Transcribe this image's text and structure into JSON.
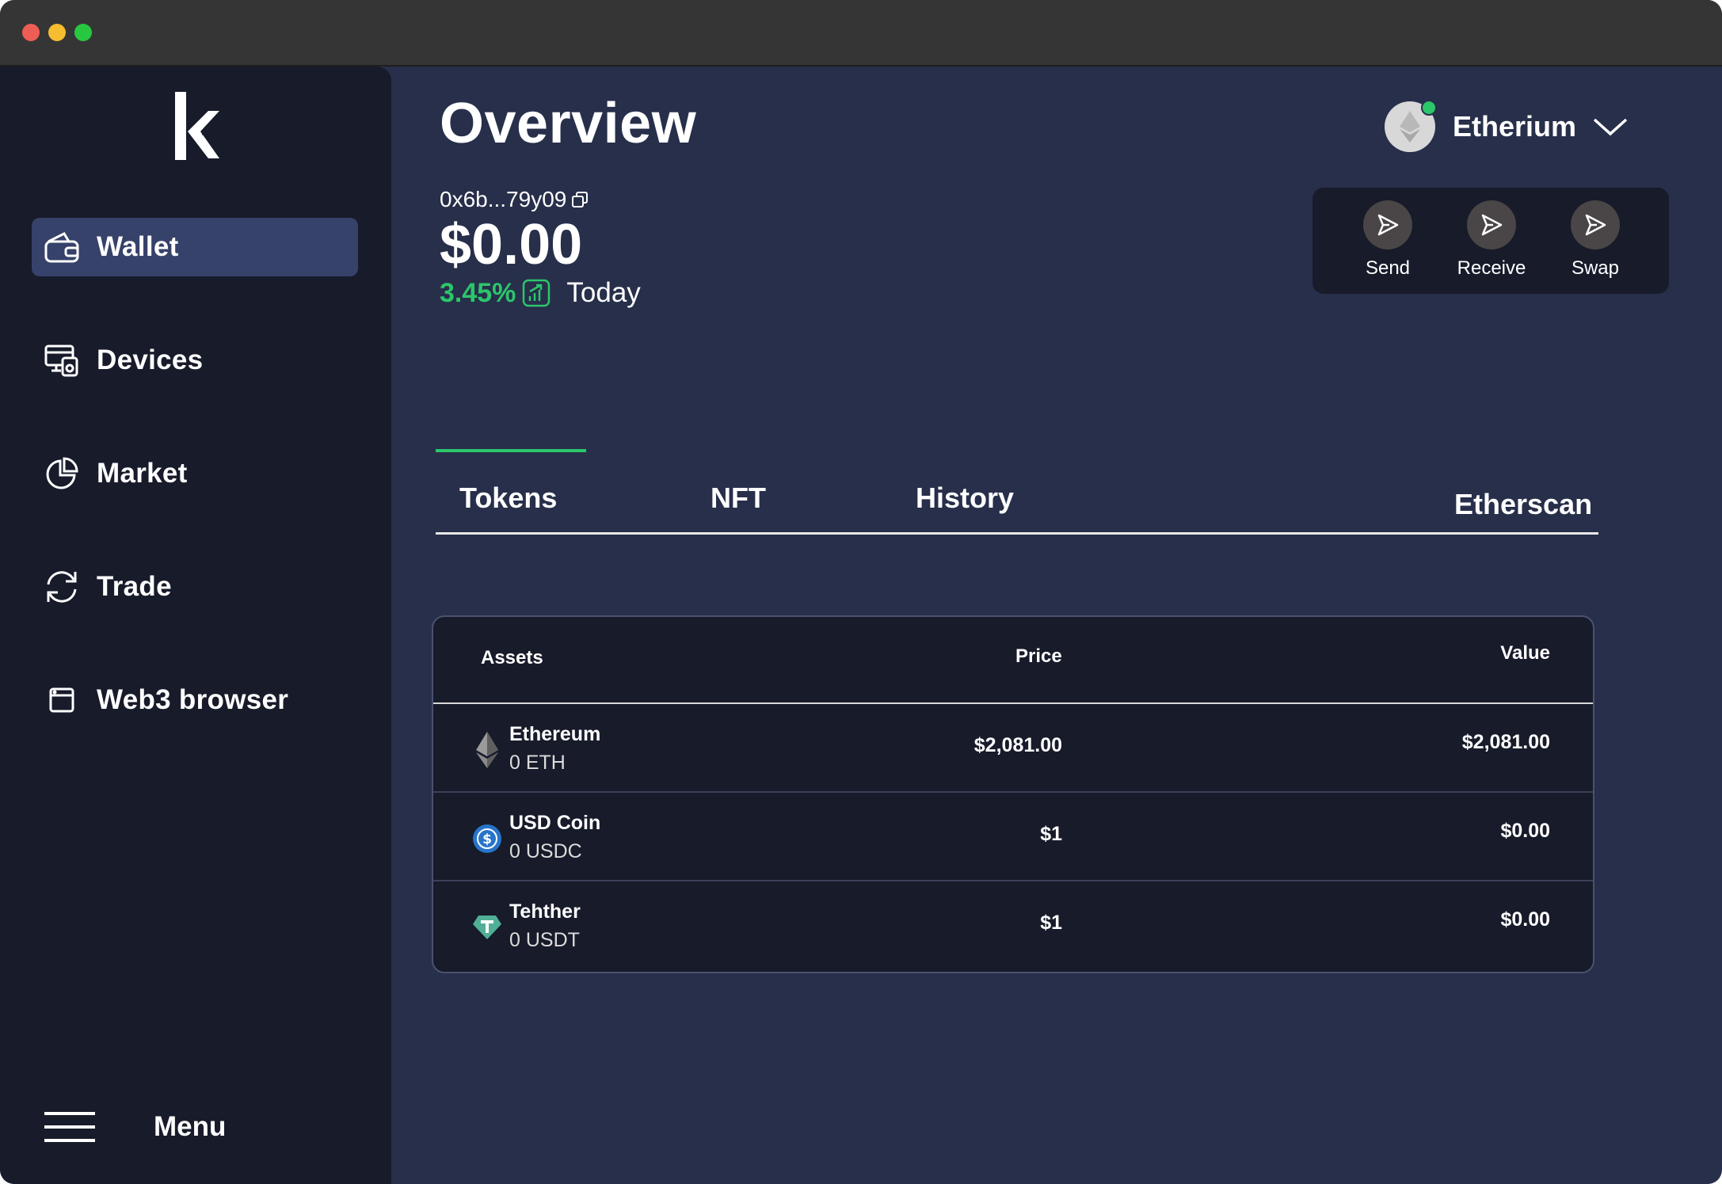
{
  "sidebar": {
    "logo": "k",
    "items": [
      {
        "label": "Wallet",
        "icon": "wallet-icon",
        "active": true
      },
      {
        "label": "Devices",
        "icon": "devices-icon",
        "active": false
      },
      {
        "label": "Market",
        "icon": "pie-chart-icon",
        "active": false
      },
      {
        "label": "Trade",
        "icon": "refresh-icon",
        "active": false
      },
      {
        "label": "Web3 browser",
        "icon": "browser-icon",
        "active": false
      }
    ],
    "menu_label": "Menu"
  },
  "header": {
    "title": "Overview",
    "address": "0x6b...79y09",
    "balance": "$0.00",
    "change_pct": "3.45%",
    "change_period": "Today"
  },
  "network": {
    "label": "Etherium"
  },
  "actions": [
    {
      "label": "Send"
    },
    {
      "label": "Receive"
    },
    {
      "label": "Swap"
    }
  ],
  "tabs": [
    {
      "label": "Tokens",
      "active": true
    },
    {
      "label": "NFT"
    },
    {
      "label": "History"
    },
    {
      "label": "Etherscan"
    }
  ],
  "table": {
    "columns": [
      "Assets",
      "Price",
      "Value"
    ],
    "rows": [
      {
        "name": "Ethereum",
        "amount": "0 ETH",
        "price": "$2,081.00",
        "value": "$2,081.00",
        "icon": "ethereum-icon"
      },
      {
        "name": "USD Coin",
        "amount": "0 USDC",
        "price": "$1",
        "value": "$0.00",
        "icon": "usdc-icon"
      },
      {
        "name": "Tehther",
        "amount": "0 USDT",
        "price": "$1",
        "value": "$0.00",
        "icon": "tether-icon"
      }
    ]
  },
  "colors": {
    "accent_green": "#2cc66b",
    "sidebar_bg": "#171b2a",
    "main_bg": "#272f4a",
    "active_nav": "#36426a"
  }
}
